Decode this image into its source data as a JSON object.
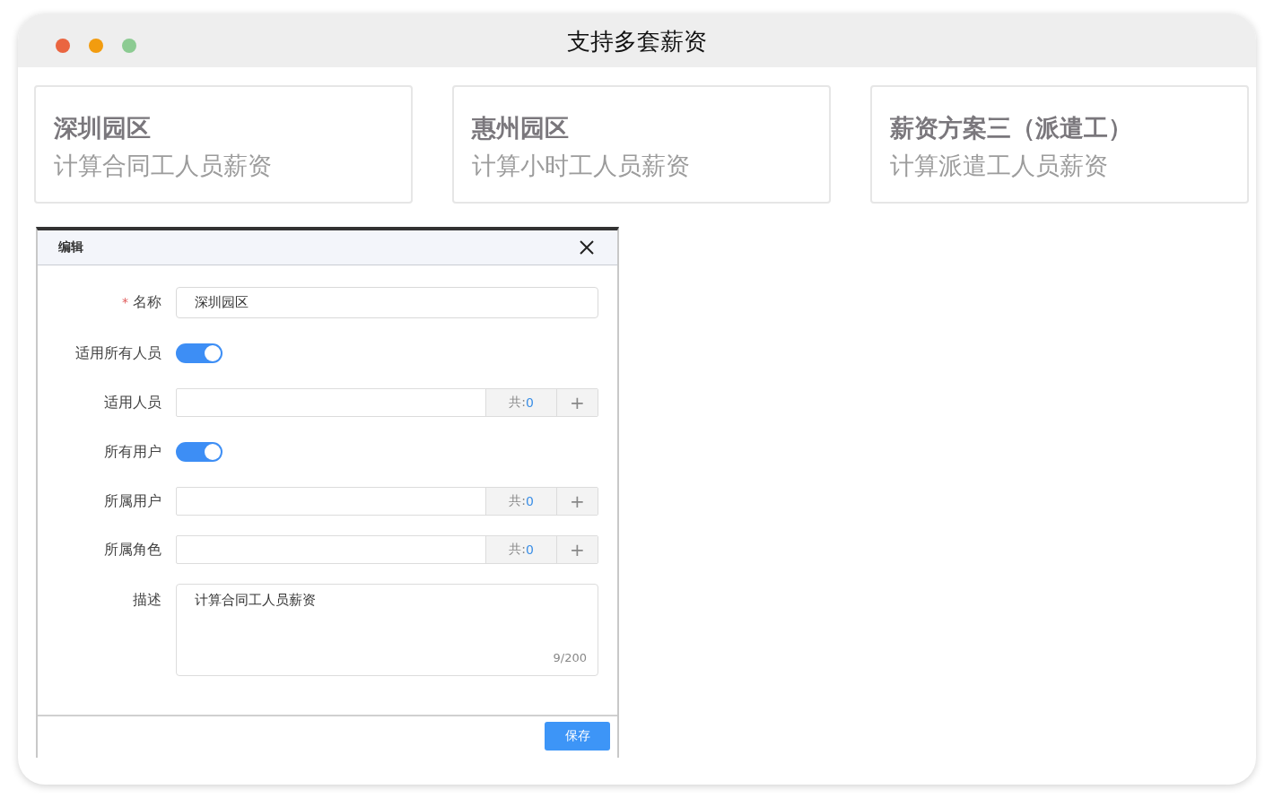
{
  "window": {
    "title": "支持多套薪资"
  },
  "cards": [
    {
      "title": "深圳园区",
      "subtitle": "计算合同工人员薪资"
    },
    {
      "title": "惠州园区",
      "subtitle": "计算小时工人员薪资"
    },
    {
      "title": "薪资方案三（派遣工）",
      "subtitle": "计算派遣工人员薪资"
    }
  ],
  "dialog": {
    "title": "编辑",
    "fields": [
      {
        "kind": "text",
        "label": "名称",
        "required": true,
        "required_mark": "*",
        "value": "深圳园区"
      },
      {
        "kind": "switch",
        "label": "适用所有人员",
        "on": true
      },
      {
        "kind": "picker",
        "label": "适用人员",
        "count_label": "共:",
        "count": "0",
        "add": "+"
      },
      {
        "kind": "switch",
        "label": "所有用户",
        "on": true
      },
      {
        "kind": "picker",
        "label": "所属用户",
        "count_label": "共:",
        "count": "0",
        "add": "+"
      },
      {
        "kind": "picker",
        "label": "所属角色",
        "count_label": "共:",
        "count": "0",
        "add": "+"
      },
      {
        "kind": "textarea",
        "label": "描述",
        "value": "计算合同工人员薪资",
        "counter": "9/200"
      }
    ],
    "save_button": "保存"
  }
}
